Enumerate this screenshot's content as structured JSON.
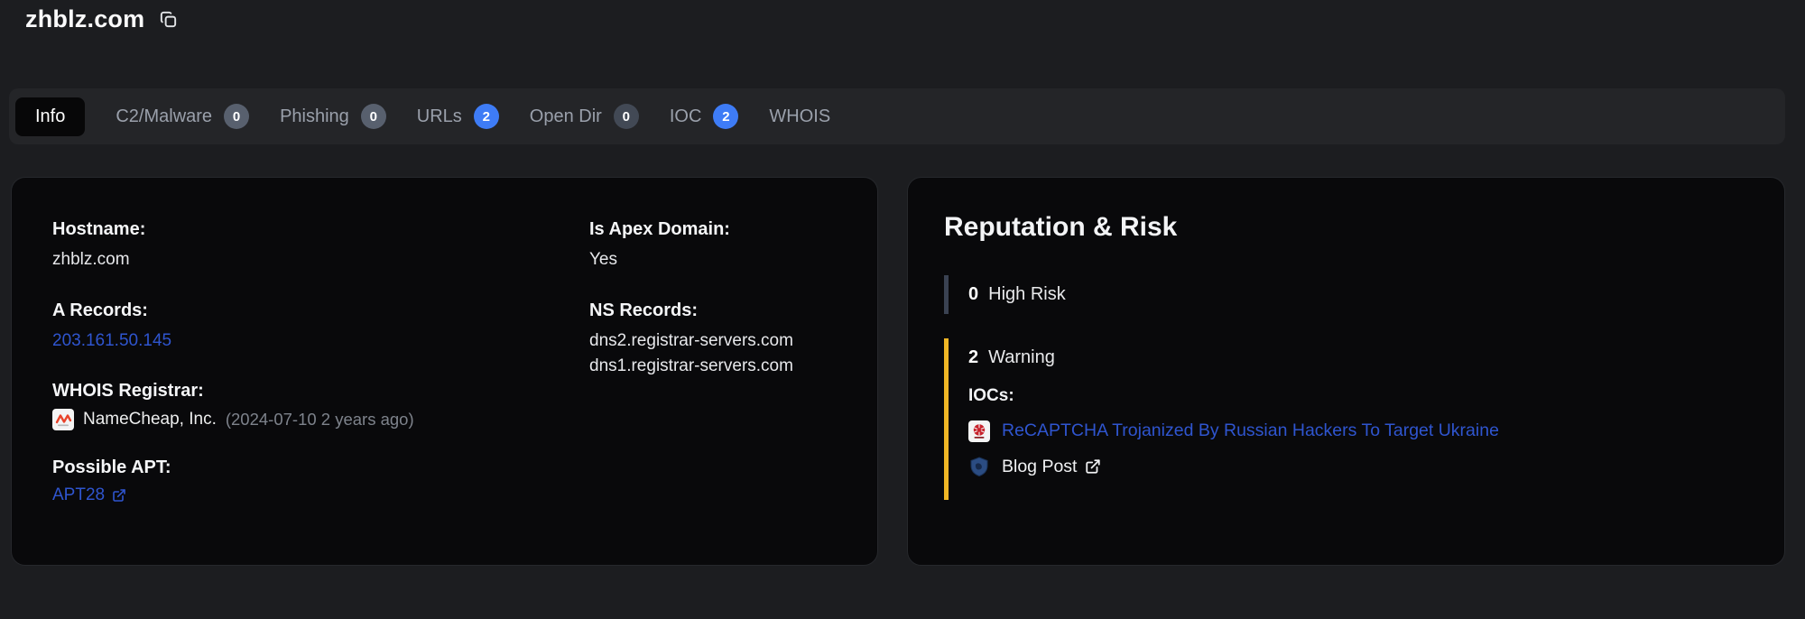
{
  "header": {
    "title": "zhblz.com",
    "copy_icon": "copy-icon"
  },
  "tabs": [
    {
      "label": "Info",
      "active": true
    },
    {
      "label": "C2/Malware",
      "count": "0",
      "badge": "gray"
    },
    {
      "label": "Phishing",
      "count": "0",
      "badge": "gray"
    },
    {
      "label": "URLs",
      "count": "2",
      "badge": "blue"
    },
    {
      "label": "Open Dir",
      "count": "0",
      "badge": "darkgray"
    },
    {
      "label": "IOC",
      "count": "2",
      "badge": "blue"
    },
    {
      "label": "WHOIS"
    }
  ],
  "info_card": {
    "hostname": {
      "label": "Hostname:",
      "value": "zhblz.com"
    },
    "a_records": {
      "label": "A Records:",
      "values": [
        "203.161.50.145"
      ]
    },
    "whois_registrar": {
      "label": "WHOIS Registrar:",
      "name": "NameCheap, Inc.",
      "date_note": "(2024-07-10 2 years ago)",
      "icon": "namecheap-favicon"
    },
    "possible_apt": {
      "label": "Possible APT:",
      "link_text": "APT28",
      "icon": "external-link-icon"
    },
    "is_apex_domain": {
      "label": "Is Apex Domain:",
      "value": "Yes"
    },
    "ns_records": {
      "label": "NS Records:",
      "values": [
        "dns2.registrar-servers.com",
        "dns1.registrar-servers.com"
      ]
    }
  },
  "reputation_card": {
    "title": "Reputation & Risk",
    "high_risk": {
      "count": "0",
      "label": "High Risk"
    },
    "warning": {
      "count": "2",
      "label": "Warning"
    },
    "iocs_label": "IOCs:",
    "ioc_items": [
      {
        "title": "ReCAPTCHA Trojanized By Russian Hackers To Target Ukraine",
        "icon": "news-site-favicon",
        "kind": "link"
      },
      {
        "title": "Blog Post",
        "icon": "shield-favicon",
        "kind": "external-link"
      }
    ]
  },
  "colors": {
    "page-bg": "#1c1d20",
    "tabbar-bg": "#242528",
    "card-bg": "#09090b",
    "tab-fg": "#9aa0ab",
    "badge-gray": "#58606e",
    "badge-darkgray": "#424955",
    "badge-blue": "#3e7cf6",
    "link-blue": "#2f55cf",
    "muted-gray": "#7e838c",
    "warning-yellow": "#f0b625",
    "highrisk-border": "#3a4252"
  }
}
